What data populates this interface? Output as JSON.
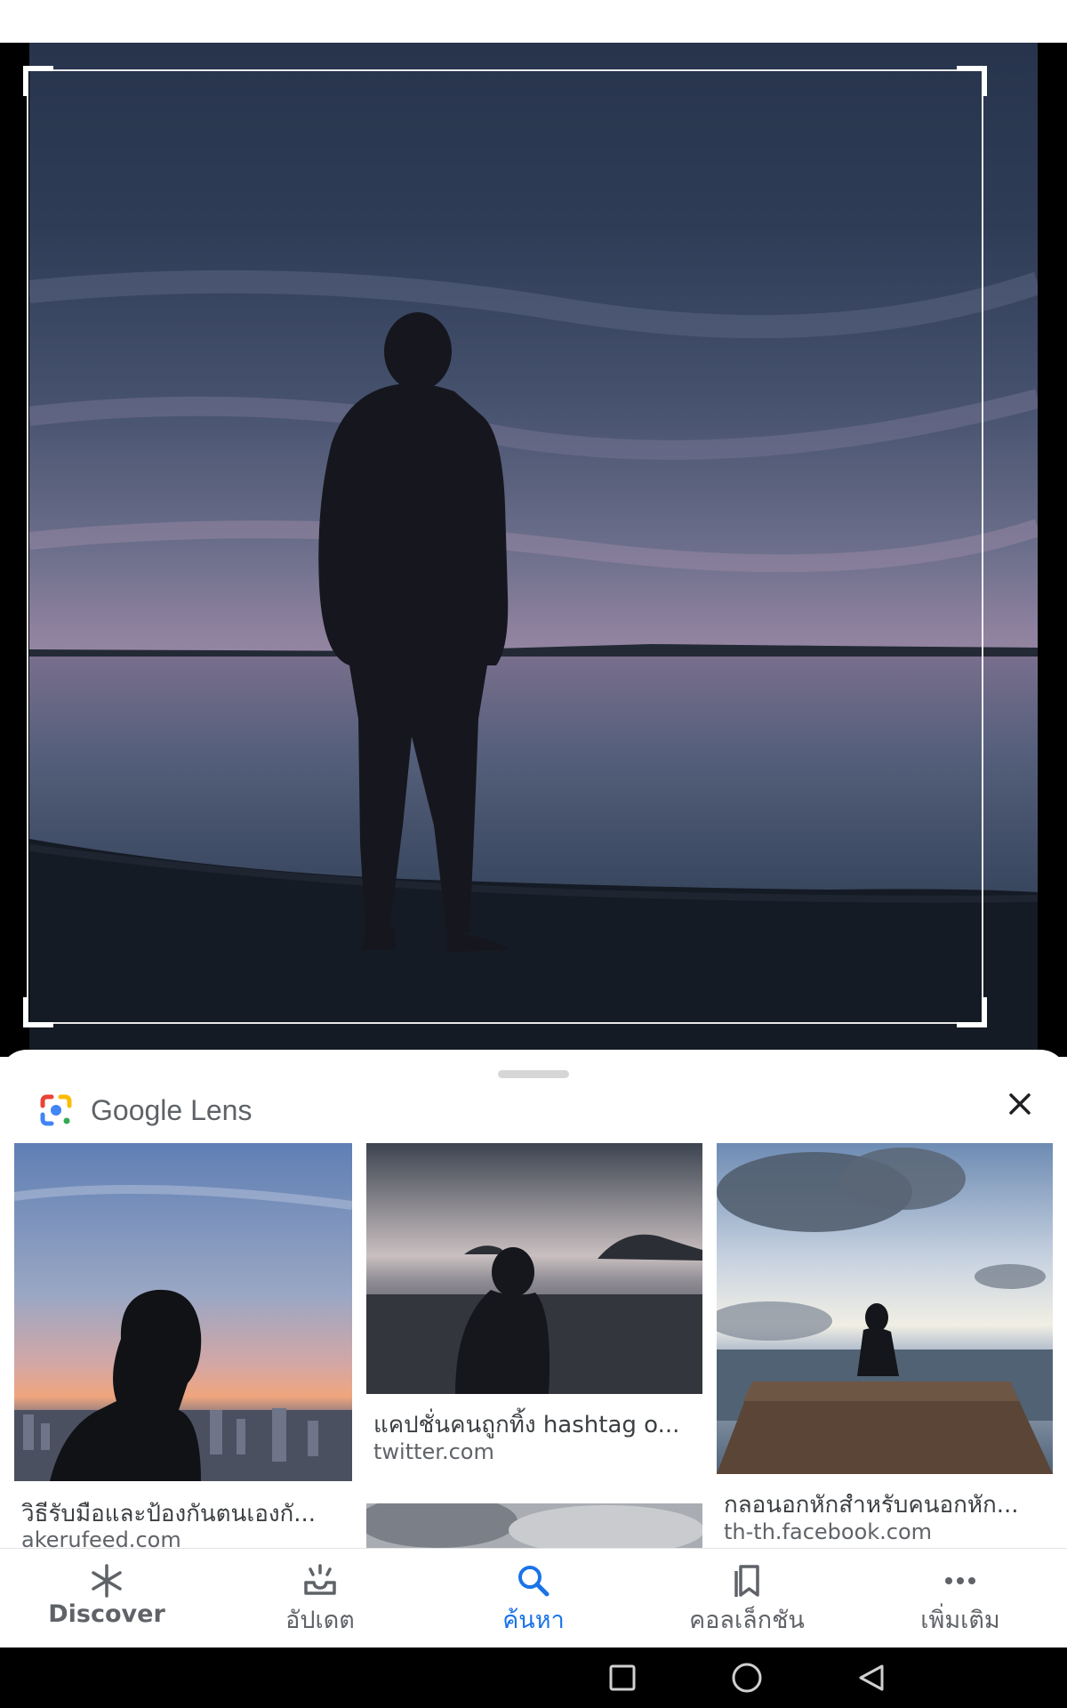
{
  "app": {
    "brand_word": "Google",
    "product_word": "Lens"
  },
  "colors": {
    "accent": "#1a73e8",
    "text_primary": "#3c4043",
    "text_secondary": "#5f6368"
  },
  "results": [
    {
      "title": "วิธีรับมือและป้องกันตนเองกั...",
      "source": "akerufeed.com",
      "thumb": "girl-silhouette-sunset-city"
    },
    {
      "title": "แคปชั่นคนถูกทิ้ง hashtag o...",
      "source": "twitter.com",
      "thumb": "girl-silhouette-beach-dusk"
    },
    {
      "title": "",
      "source": "",
      "thumb": "cloudy-sky"
    },
    {
      "title": "กลอนอกหักสำหรับคนอกหัก...",
      "source": "th-th.facebook.com",
      "thumb": "woman-sitting-on-pier"
    }
  ],
  "bottom_nav": {
    "items": [
      {
        "label": "Discover",
        "icon": "asterisk-icon",
        "active": false
      },
      {
        "label": "อัปเดต",
        "icon": "inbox-tray-icon",
        "active": false
      },
      {
        "label": "ค้นหา",
        "icon": "search-icon",
        "active": true
      },
      {
        "label": "คอลเล็กชัน",
        "icon": "collections-bookmark-icon",
        "active": false
      },
      {
        "label": "เพิ่มเติม",
        "icon": "more-horizontal-icon",
        "active": false
      }
    ]
  },
  "system_nav": {
    "buttons": [
      "recents-square-icon",
      "home-circle-icon",
      "back-triangle-icon"
    ]
  }
}
